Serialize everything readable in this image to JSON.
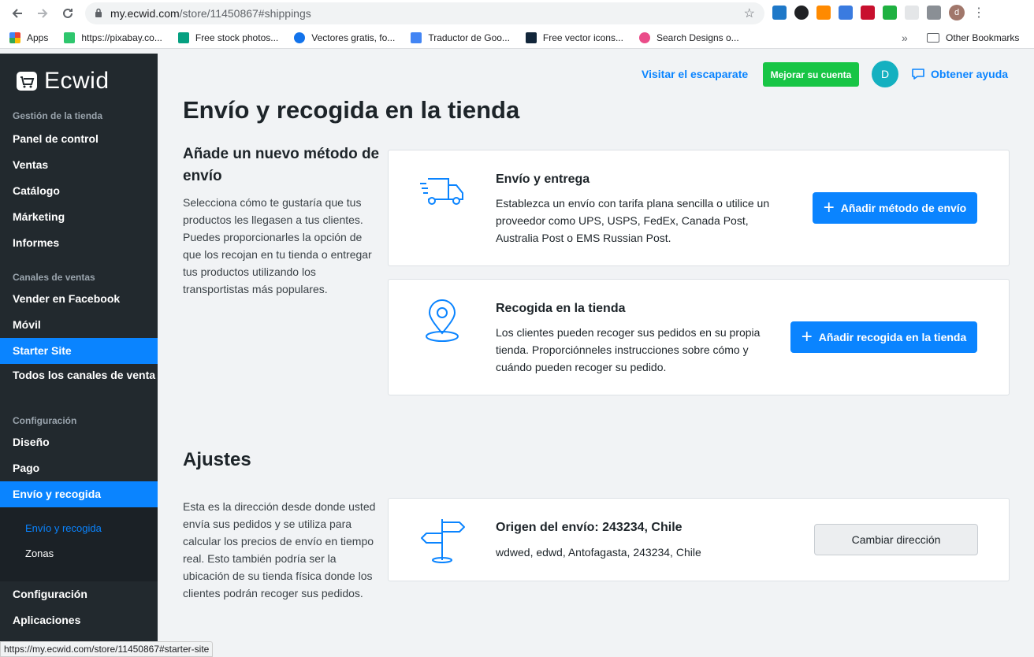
{
  "browser": {
    "url_host": "my.ecwid.com",
    "url_path": "/store/11450867#shippings",
    "profile_initial": "d",
    "bookmarks": [
      {
        "label": "Apps",
        "icon": "apps-grid-icon",
        "color": "#ea4335"
      },
      {
        "label": "https://pixabay.co...",
        "icon": "pixabay-icon",
        "color": "#2ec66d"
      },
      {
        "label": "Free stock photos...",
        "icon": "pexels-icon",
        "color": "#05a081"
      },
      {
        "label": "Vectores gratis, fo...",
        "icon": "freepik-icon",
        "color": "#1273eb"
      },
      {
        "label": "Traductor de Goo...",
        "icon": "google-translate-icon",
        "color": "#4285f4"
      },
      {
        "label": "Free vector icons...",
        "icon": "flaticon-icon",
        "color": "#12263a"
      },
      {
        "label": "Search Designs o...",
        "icon": "dribbble-icon",
        "color": "#ea4c89"
      }
    ],
    "other_bookmarks": "Other Bookmarks",
    "status_url": "https://my.ecwid.com/store/11450867#starter-site"
  },
  "sidebar": {
    "logo": "Ecwid",
    "section_store": "Gestión de la tienda",
    "items_store": [
      "Panel de control",
      "Ventas",
      "Catálogo",
      "Márketing",
      "Informes"
    ],
    "section_channels": "Canales de ventas",
    "items_channels": [
      "Vender en Facebook",
      "Móvil",
      "Starter Site",
      "Todos los canales de venta"
    ],
    "section_config": "Configuración",
    "items_config": [
      "Diseño",
      "Pago",
      "Envío y recogida"
    ],
    "subitems": [
      "Envío y recogida",
      "Zonas"
    ],
    "items_bottom": [
      "Configuración",
      "Aplicaciones"
    ]
  },
  "topbar": {
    "visit_store": "Visitar el escaparate",
    "upgrade": "Mejorar su cuenta",
    "avatar_initial": "D",
    "help": "Obtener ayuda"
  },
  "page": {
    "title": "Envío y recogida en la tienda",
    "add_method_heading": "Añade un nuevo método de envío",
    "add_method_desc": "Selecciona cómo te gustaría que tus productos les llegasen a tus clientes. Puedes proporcionarles la opción de que los recojan en tu tienda o entregar tus productos utilizando los transportistas más populares.",
    "delivery_card": {
      "title": "Envío y entrega",
      "text": "Establezca un envío con tarifa plana sencilla o utilice un proveedor como UPS, USPS, FedEx, Canada Post, Australia Post o EMS Russian Post.",
      "button": "Añadir método de envío",
      "icon": "delivery-truck-icon"
    },
    "pickup_card": {
      "title": "Recogida en la tienda",
      "text": "Los clientes pueden recoger sus pedidos en su propia tienda. Proporciónneles instrucciones sobre cómo y cuándo pueden recoger su pedido.",
      "button": "Añadir recogida en la tienda",
      "icon": "map-pin-icon"
    },
    "settings_heading": "Ajustes",
    "settings_desc": "Esta es la dirección desde donde usted envía sus pedidos y se utiliza para calcular los precios de envío en tiempo real. Esto también podría ser la ubicación de su tienda física donde los clientes podrán recoger sus pedidos.",
    "origin_card": {
      "title": "Origen del envío: 243234, Chile",
      "address": "wdwed, edwd, Antofagasta, 243234, Chile",
      "button": "Cambiar dirección",
      "icon": "signpost-icon"
    }
  },
  "colors": {
    "accent": "#0a84ff",
    "success": "#18c545",
    "sidebar_bg": "#22292e",
    "avatar": "#14b0c0"
  }
}
